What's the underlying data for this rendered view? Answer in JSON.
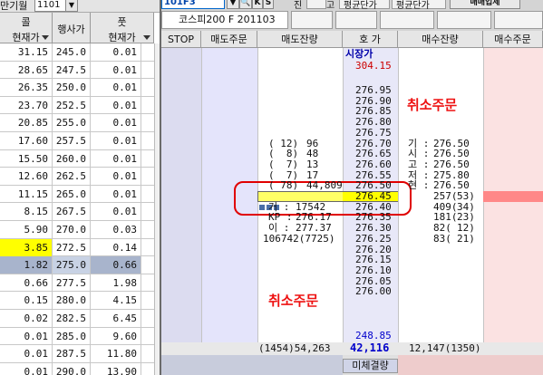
{
  "left": {
    "top_label": "만기월",
    "month_value": "1101",
    "call_header": "콜",
    "put_header": "풋",
    "col_price": "현재가",
    "col_strike": "행사가",
    "col_price2": "현재가",
    "rows": [
      {
        "call": "31.15",
        "strike": "245.0",
        "put": "0.01"
      },
      {
        "call": "28.65",
        "strike": "247.5",
        "put": "0.01"
      },
      {
        "call": "26.35",
        "strike": "250.0",
        "put": "0.01"
      },
      {
        "call": "23.70",
        "strike": "252.5",
        "put": "0.01"
      },
      {
        "call": "20.85",
        "strike": "255.0",
        "put": "0.01"
      },
      {
        "call": "17.60",
        "strike": "257.5",
        "put": "0.01"
      },
      {
        "call": "15.50",
        "strike": "260.0",
        "put": "0.01"
      },
      {
        "call": "12.60",
        "strike": "262.5",
        "put": "0.01"
      },
      {
        "call": "11.15",
        "strike": "265.0",
        "put": "0.01"
      },
      {
        "call": "8.15",
        "strike": "267.5",
        "put": "0.01"
      },
      {
        "call": "5.90",
        "strike": "270.0",
        "put": "0.03"
      },
      {
        "call": "3.85",
        "strike": "272.5",
        "put": "0.14"
      },
      {
        "call": "1.82",
        "strike": "275.0",
        "put": "0.66"
      },
      {
        "call": "0.66",
        "strike": "277.5",
        "put": "1.98"
      },
      {
        "call": "0.15",
        "strike": "280.0",
        "put": "4.15"
      },
      {
        "call": "0.02",
        "strike": "282.5",
        "put": "6.45"
      },
      {
        "call": "0.01",
        "strike": "285.0",
        "put": "9.60"
      },
      {
        "call": "0.01",
        "strike": "287.5",
        "put": "11.80"
      },
      {
        "call": "0.01",
        "strike": "290.0",
        "put": "13.90"
      }
    ]
  },
  "toolbar": {
    "code": "101F3",
    "btn_k": "K",
    "btn_s": "S",
    "label_jin": "진",
    "label_go": "고",
    "label_pyeong": "평균단가",
    "label_pyeong2": "평균단가",
    "label_order": "매매입체",
    "name": "코스피200 F 201103"
  },
  "order_header": {
    "stop": "STOP",
    "sell_order": "매도주문",
    "sell_remain": "매도잔량",
    "price": "호    가",
    "buy_remain": "매수잔량",
    "buy_order": "매수주문"
  },
  "orderbook": {
    "market_label": "시장가",
    "upper_limit": "304.15",
    "lower_limit": "248.85",
    "prices": [
      "276.95",
      "276.90",
      "276.85",
      "276.80",
      "276.75",
      "276.70",
      "276.65",
      "276.60",
      "276.55",
      "276.50",
      "276.45",
      "276.40",
      "276.35",
      "276.30",
      "276.25",
      "276.20",
      "276.15",
      "276.10",
      "276.05",
      "276.00"
    ],
    "sell_rows": [
      {
        "count": "( 12)",
        "qty": "96"
      },
      {
        "count": "(  8)",
        "qty": "48"
      },
      {
        "count": "(  7)",
        "qty": "13"
      },
      {
        "count": "(  7)",
        "qty": "17"
      },
      {
        "count": "( 78)",
        "qty": "44,809"
      }
    ],
    "stats": [
      {
        "label": "거 :",
        "value": "17542"
      },
      {
        "label": "KP :",
        "value": "276.17"
      },
      {
        "label": "이 :",
        "value": "277.37"
      }
    ],
    "stat_extra": "106742(7725)",
    "info": [
      {
        "label": "기 :",
        "value": "276.50"
      },
      {
        "label": "시 :",
        "value": "276.50"
      },
      {
        "label": "고 :",
        "value": "276.50"
      },
      {
        "label": "저 :",
        "value": "275.80"
      },
      {
        "label": "현 :",
        "value": "276.50"
      }
    ],
    "buy_rows": [
      {
        "qty": "257(",
        "count": "53)"
      },
      {
        "qty": "409(",
        "count": "34)"
      },
      {
        "qty": "181(",
        "count": "23)"
      },
      {
        "qty": "82(",
        "count": "12)"
      },
      {
        "qty": "83(",
        "count": "21)"
      }
    ],
    "cancel_label_1": "취소주문",
    "cancel_label_2": "취소주문",
    "total_sell": "(1454)54,263",
    "total_mid": "42,116",
    "total_buy": "12,147(1350)",
    "unfilled": "미체결량"
  }
}
